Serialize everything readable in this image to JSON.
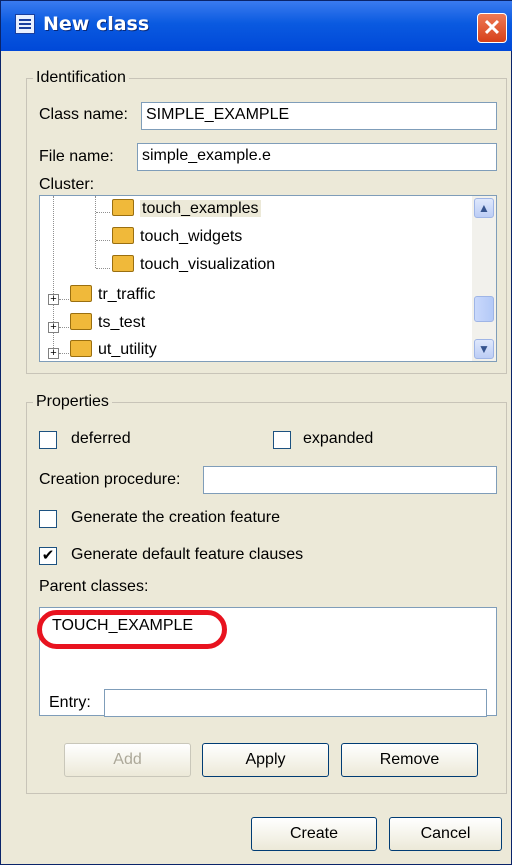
{
  "window": {
    "title": "New class",
    "close_glyph": "✕"
  },
  "identification": {
    "legend": "Identification",
    "class_name_label": "Class name:",
    "class_name_value": "SIMPLE_EXAMPLE",
    "file_name_label": "File name:",
    "file_name_value": "simple_example.e",
    "cluster_label": "Cluster:",
    "clusters": [
      {
        "label": "touch_examples",
        "selected": true
      },
      {
        "label": "touch_widgets"
      },
      {
        "label": "touch_visualization"
      },
      {
        "label": "tr_traffic",
        "expander": "+"
      },
      {
        "label": "ts_test",
        "expander": "+"
      },
      {
        "label": "ut_utility",
        "expander": "+"
      }
    ],
    "scroll_up": "▲",
    "scroll_down": "▼"
  },
  "properties": {
    "legend": "Properties",
    "deferred_label": "deferred",
    "deferred_checked": false,
    "expanded_label": "expanded",
    "expanded_checked": false,
    "creation_procedure_label": "Creation procedure:",
    "creation_procedure_value": "",
    "gen_creation_label": "Generate the creation feature",
    "gen_creation_checked": false,
    "gen_default_label": "Generate default feature clauses",
    "gen_default_checked": true,
    "check_mark": "✔",
    "parent_classes_label": "Parent classes:",
    "parent_classes": [
      "TOUCH_EXAMPLE"
    ],
    "entry_label": "Entry:",
    "entry_value": "",
    "add_label": "Add",
    "apply_label": "Apply",
    "remove_label": "Remove"
  },
  "footer": {
    "create_label": "Create",
    "cancel_label": "Cancel"
  },
  "colors": {
    "highlight": "#e8131f",
    "title_bar": "#0a5ae0",
    "dialog_bg": "#ece9d8"
  }
}
